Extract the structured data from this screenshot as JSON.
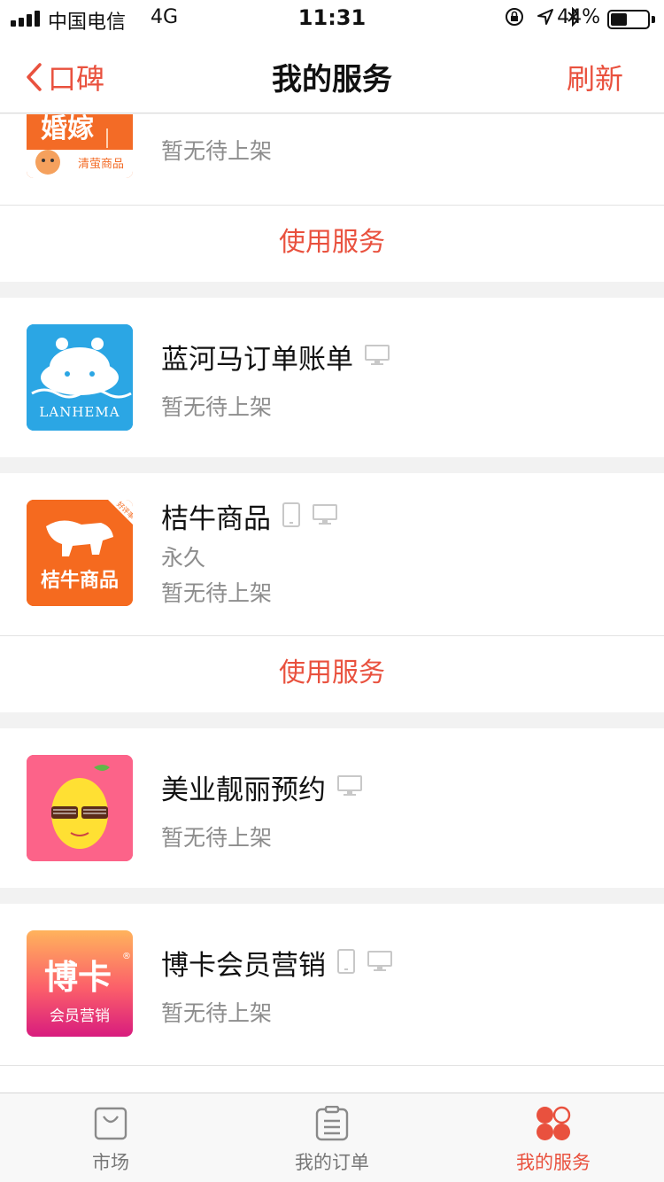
{
  "status_bar": {
    "carrier": "中国电信",
    "network": "4G",
    "time": "11:31",
    "battery_percent": "44%",
    "battery_level": 0.44
  },
  "nav": {
    "back_label": "口碑",
    "title": "我的服务",
    "refresh_label": "刷新"
  },
  "services": [
    {
      "logo_text": "婚嫁",
      "logo_subtext": "清萤商品",
      "status": "暂无待上架",
      "action": "使用服务"
    },
    {
      "name": "蓝河马订单账单",
      "logo_text": "LANHEMA",
      "status": "暂无待上架",
      "devices": [
        "desktop-icon"
      ]
    },
    {
      "name": "桔牛商品",
      "logo_text": "桔牛商品",
      "badge": "好评率",
      "duration": "永久",
      "status": "暂无待上架",
      "action": "使用服务",
      "devices": [
        "phone-icon",
        "desktop-icon"
      ]
    },
    {
      "name": "美业靓丽预约",
      "status": "暂无待上架",
      "devices": [
        "desktop-icon"
      ]
    },
    {
      "name": "博卡会员营销",
      "logo_text": "博卡",
      "logo_mark": "®",
      "logo_subtext": "会员营销",
      "status": "暂无待上架",
      "devices": [
        "phone-icon",
        "desktop-icon"
      ]
    }
  ],
  "tabs": [
    {
      "label": "市场",
      "icon": "bag-icon",
      "active": false
    },
    {
      "label": "我的订单",
      "icon": "order-list-icon",
      "active": false
    },
    {
      "label": "我的服务",
      "icon": "services-icon",
      "active": true
    }
  ],
  "colors": {
    "accent": "#e9513e",
    "muted_text": "#8d8d8d",
    "background": "#f2f2f2"
  }
}
